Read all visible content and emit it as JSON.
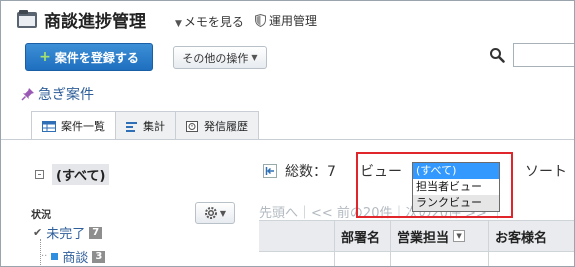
{
  "header": {
    "app_title": "商談進捗管理",
    "memo_link": "メモを見る",
    "admin_link": "運用管理"
  },
  "toolbar": {
    "register_label": "案件を登録する",
    "other_label": "その他の操作"
  },
  "category": {
    "label": "急ぎ案件"
  },
  "tabs": [
    {
      "label": "案件一覧",
      "icon": "table-icon",
      "active": true
    },
    {
      "label": "集計",
      "icon": "summary-icon",
      "active": false
    },
    {
      "label": "発信履歴",
      "icon": "history-icon",
      "active": false
    }
  ],
  "folders": {
    "all_label": "(すべて)",
    "status_heading": "状況",
    "items": [
      {
        "label": "未完了",
        "count": "7"
      },
      {
        "label": "商談",
        "count": "3"
      }
    ]
  },
  "list": {
    "total": "総数：7",
    "view_label": "ビュー",
    "sort_label": "ソート",
    "pager": "先頭へ｜<< 前の20件｜次の20件 >> ｜"
  },
  "view_dropdown": {
    "options": [
      "(すべて)",
      "担当者ビュー",
      "ランクビュー"
    ],
    "selected_index": 0
  },
  "table": {
    "columns": [
      "",
      "部署名",
      "営業担当",
      "お客様名"
    ]
  },
  "colors": {
    "accent": "#1e6fbf",
    "highlight": "#e0262a",
    "link": "#2f5f9a"
  }
}
